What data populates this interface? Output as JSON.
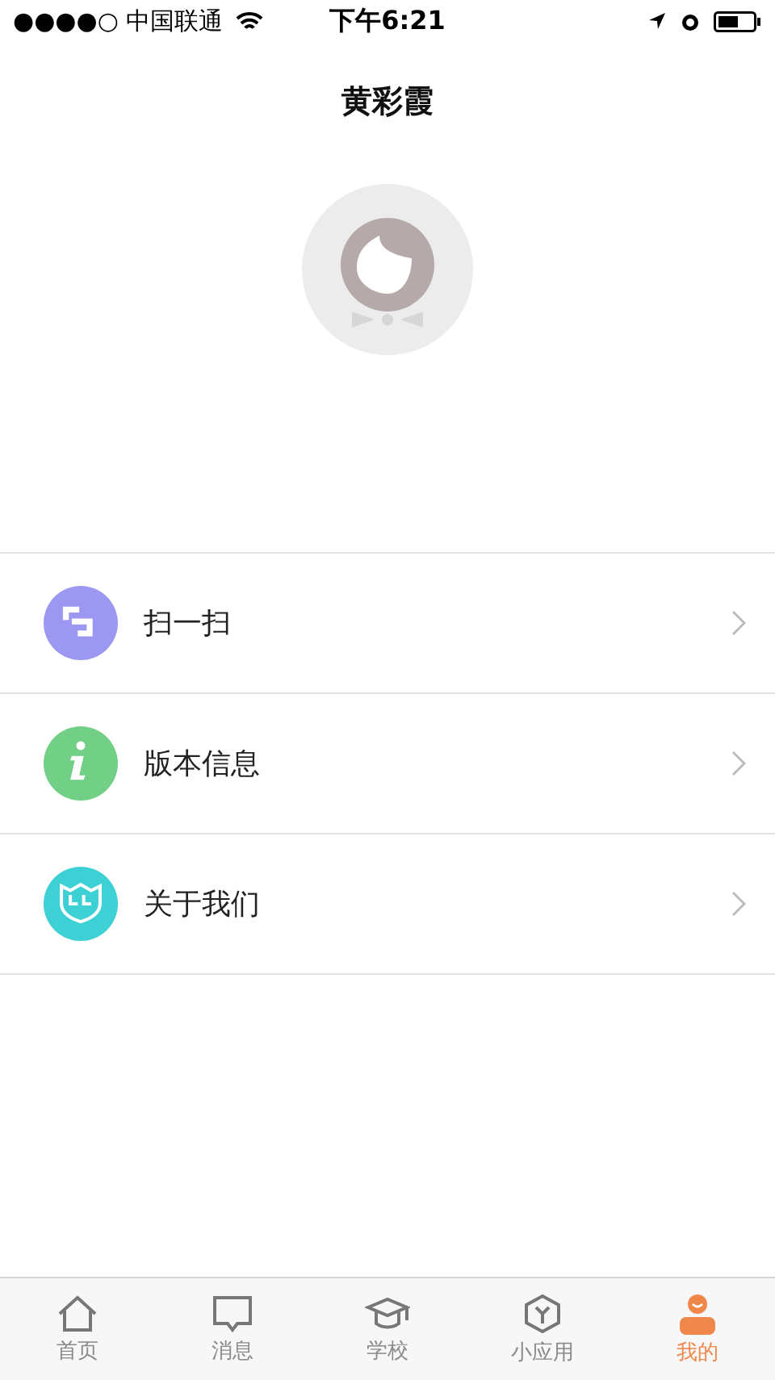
{
  "status_bar": {
    "carrier": "●●●●○ 中国联通",
    "time": "下午6:21"
  },
  "header": {
    "title": "黄彩霞"
  },
  "menu": [
    {
      "kind": "scan",
      "label": "扫一扫",
      "color": "#9c98f1"
    },
    {
      "kind": "info",
      "label": "版本信息",
      "color": "#72cf86"
    },
    {
      "kind": "about",
      "label": "关于我们",
      "color": "#3dd0d4"
    }
  ],
  "tab_bar": [
    {
      "kind": "home",
      "label": "首页",
      "selected": false
    },
    {
      "kind": "message",
      "label": "消息",
      "selected": false
    },
    {
      "kind": "school",
      "label": "学校",
      "selected": false
    },
    {
      "kind": "apps",
      "label": "小应用",
      "selected": false
    },
    {
      "kind": "me",
      "label": "我的",
      "selected": true
    }
  ]
}
